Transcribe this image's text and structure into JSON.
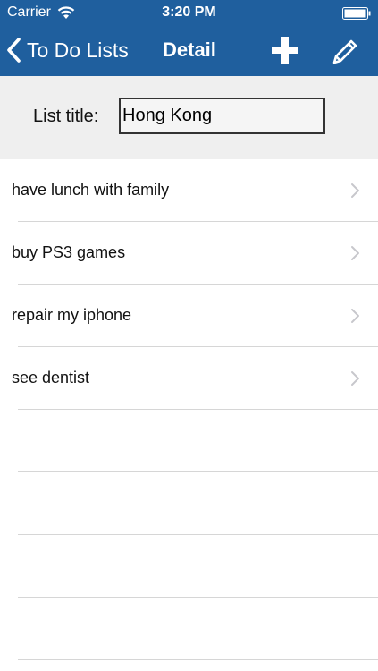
{
  "status_bar": {
    "carrier": "Carrier",
    "time": "3:20 PM"
  },
  "nav": {
    "back_label": "To Do Lists",
    "title": "Detail"
  },
  "header": {
    "label": "List title:",
    "title_value": "Hong Kong"
  },
  "items": [
    {
      "label": "have lunch with family"
    },
    {
      "label": "buy PS3 games"
    },
    {
      "label": "repair my iphone"
    },
    {
      "label": "see dentist"
    }
  ],
  "icons": {
    "back": "chevron-left-icon",
    "add": "plus-icon",
    "edit": "pencil-icon",
    "disclosure": "chevron-right-icon",
    "wifi": "wifi-icon",
    "battery": "battery-icon"
  },
  "colors": {
    "nav_background": "#1f5f9e",
    "header_background": "#efefef"
  }
}
